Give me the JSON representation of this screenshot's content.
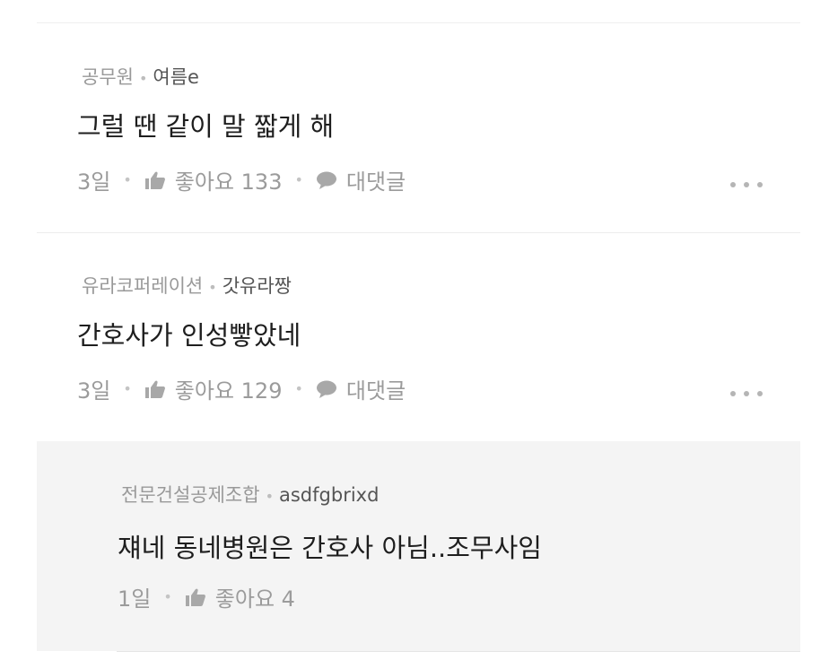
{
  "comments": [
    {
      "org": "공무원",
      "nickname": "여름e",
      "text": "그럴 땐 같이 말 짧게 해",
      "time": "3일",
      "like_label": "좋아요 133",
      "reply_label": "대댓글"
    },
    {
      "org": "유라코퍼레이션",
      "nickname": "갓유라짱",
      "text": "간호사가 인성빻았네",
      "time": "3일",
      "like_label": "좋아요 129",
      "reply_label": "대댓글"
    }
  ],
  "reply": {
    "org": "전문건설공제조합",
    "nickname": "asdfgbrixd",
    "text": "쟤네 동네병원은 간호사 아님..조무사임",
    "time": "1일",
    "like_label": "좋아요 4"
  },
  "icons": {
    "like": "thumbs-up-icon",
    "reply": "speech-bubble-icon",
    "more": "more-dots-icon"
  },
  "colors": {
    "meta_text": "#999999",
    "body_text": "#1e1e1e",
    "reply_background": "#f4f4f4"
  }
}
